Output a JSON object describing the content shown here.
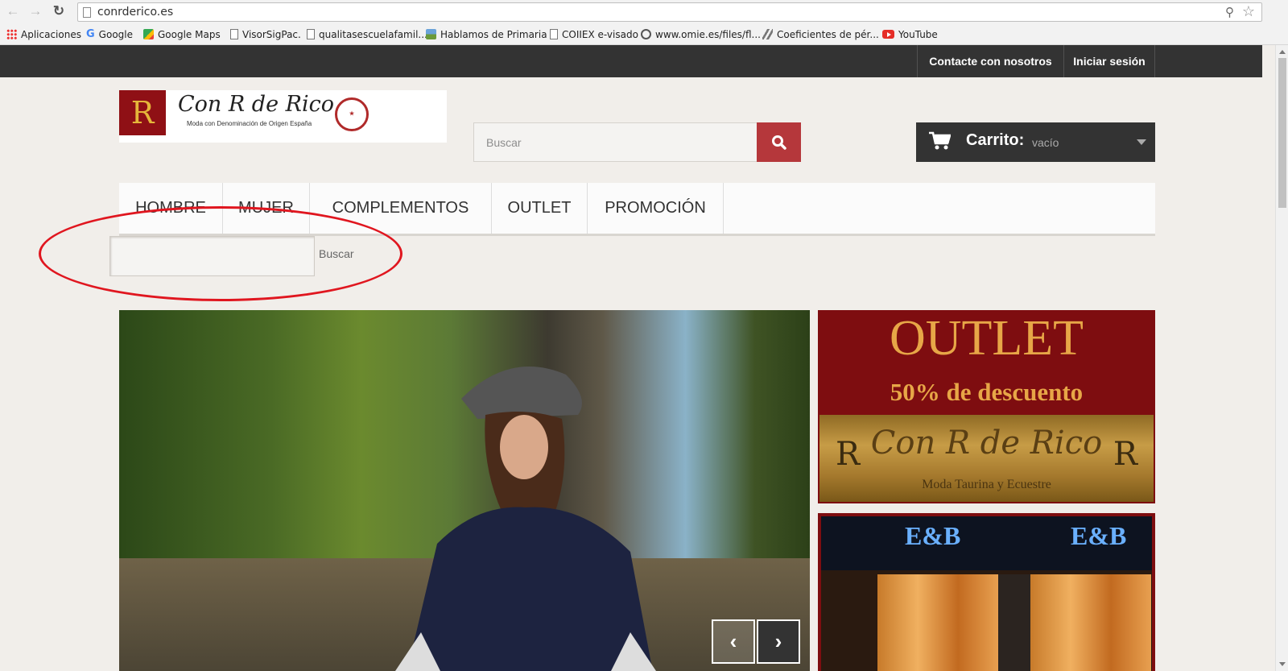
{
  "browser": {
    "url": "conrderico.es",
    "bookmarks": [
      {
        "label": "Aplicaciones",
        "icon": "apps-icon"
      },
      {
        "label": "Google",
        "icon": "google-icon"
      },
      {
        "label": "Google Maps",
        "icon": "maps-icon"
      },
      {
        "label": "VisorSigPac.",
        "icon": "page-icon"
      },
      {
        "label": "qualitasescuelafamil...",
        "icon": "page-icon"
      },
      {
        "label": "Hablamos de Primaria",
        "icon": "image-icon"
      },
      {
        "label": "COIIEX e-visado",
        "icon": "page-icon"
      },
      {
        "label": "www.omie.es/files/fl...",
        "icon": "globe-icon"
      },
      {
        "label": "Coeficientes de pér...",
        "icon": "bird-icon"
      },
      {
        "label": "YouTube",
        "icon": "youtube-icon"
      }
    ]
  },
  "topbar": {
    "contact": "Contacte con nosotros",
    "login": "Iniciar sesión"
  },
  "logo": {
    "monogram": "R",
    "name": "Con R de Rico",
    "tagline": "Moda con Denominación de Origen España"
  },
  "search": {
    "placeholder": "Buscar"
  },
  "cart": {
    "label": "Carrito:",
    "state": "vacío"
  },
  "menu": {
    "items": [
      "HOMBRE",
      "MUJER",
      "COMPLEMENTOS",
      "OUTLET",
      "PROMOCIÓN"
    ]
  },
  "side_search": {
    "button": "Buscar"
  },
  "banners": {
    "outlet_title": "OUTLET",
    "outlet_sub": "50% de descuento",
    "brand": "Con R de Rico",
    "brand_tag": "Moda Taurina y Ecuestre",
    "crest": "R",
    "store_sign": "E&B"
  },
  "colors": {
    "accent": "#b5373b",
    "dark": "#333333",
    "annotation": "#e0161f",
    "banner_bg": "#7e0d10",
    "banner_text": "#e7a647"
  }
}
